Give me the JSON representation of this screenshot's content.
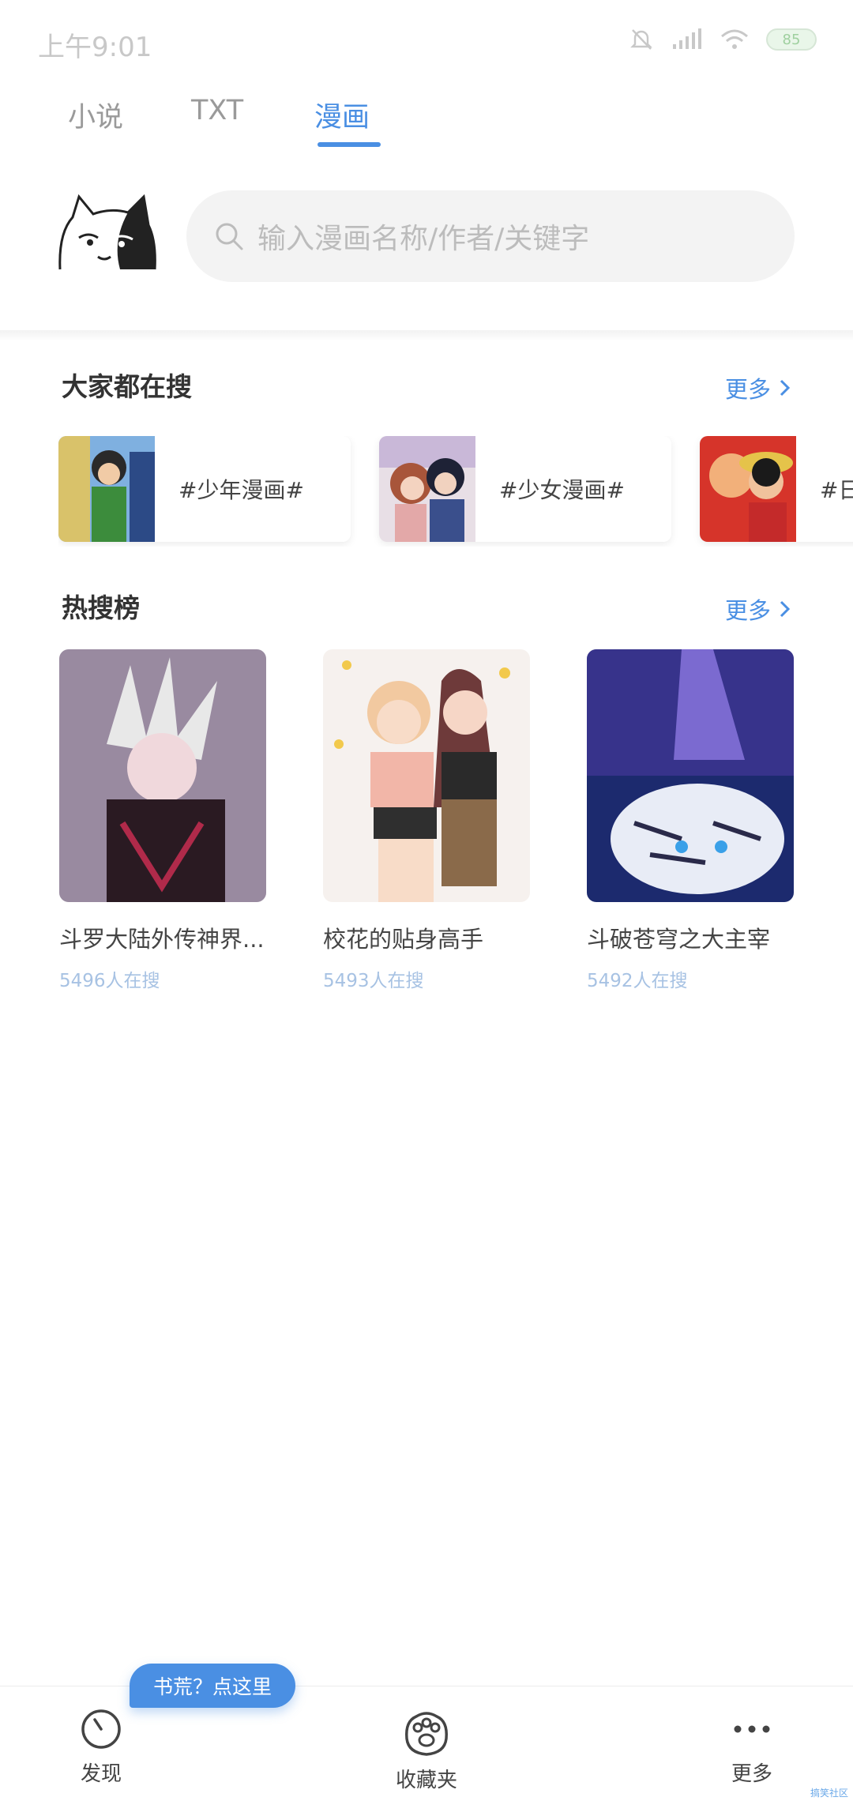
{
  "status_bar": {
    "time": "上午9:01",
    "battery": "85"
  },
  "tabs": [
    {
      "label": "小说"
    },
    {
      "label": "TXT"
    },
    {
      "label": "漫画"
    }
  ],
  "search": {
    "placeholder": "输入漫画名称/作者/关键字"
  },
  "popular": {
    "title": "大家都在搜",
    "more": "更多",
    "tags": [
      {
        "label": "#少年漫画#"
      },
      {
        "label": "#少女漫画#"
      },
      {
        "label": "#日"
      }
    ]
  },
  "hot": {
    "title": "热搜榜",
    "more": "更多",
    "items": [
      {
        "title": "斗罗大陆外传神界...",
        "count": "5496人在搜"
      },
      {
        "title": "校花的贴身高手",
        "count": "5493人在搜"
      },
      {
        "title": "斗破苍穹之大主宰",
        "count": "5492人在搜"
      }
    ]
  },
  "float_button": {
    "label": "书荒？点这里"
  },
  "bottom_nav": [
    {
      "label": "发现"
    },
    {
      "label": "收藏夹"
    },
    {
      "label": "更多"
    }
  ],
  "watermark": "搞笑社区",
  "colors": {
    "accent": "#4a8fe3",
    "count_text": "#a7c2e3"
  }
}
